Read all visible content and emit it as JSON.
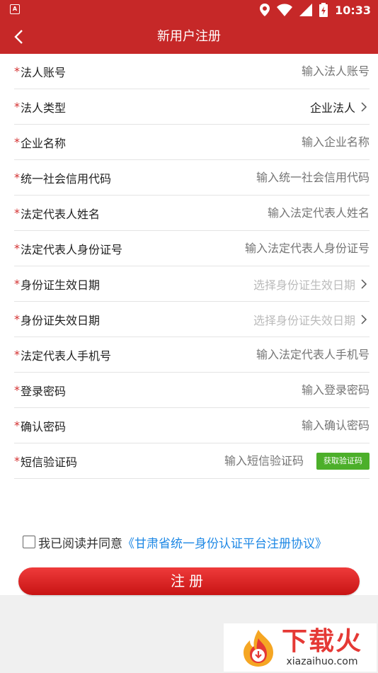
{
  "status": {
    "time": "10:33",
    "app_icon_letter": "A"
  },
  "header": {
    "title": "新用户注册"
  },
  "form": {
    "required_mark": "*",
    "fields": [
      {
        "label": "法人账号",
        "placeholder": "输入法人账号",
        "value": "",
        "type": "input"
      },
      {
        "label": "法人类型",
        "placeholder": "",
        "value": "企业法人",
        "type": "select"
      },
      {
        "label": "企业名称",
        "placeholder": "输入企业名称",
        "value": "",
        "type": "input"
      },
      {
        "label": "统一社会信用代码",
        "placeholder": "输入统一社会信用代码",
        "value": "",
        "type": "input"
      },
      {
        "label": "法定代表人姓名",
        "placeholder": "输入法定代表人姓名",
        "value": "",
        "type": "input"
      },
      {
        "label": "法定代表人身份证号",
        "placeholder": "输入法定代表人身份证号",
        "value": "",
        "type": "input"
      },
      {
        "label": "身份证生效日期",
        "placeholder": "选择身份证生效日期",
        "value": "",
        "type": "date"
      },
      {
        "label": "身份证失效日期",
        "placeholder": "选择身份证失效日期",
        "value": "",
        "type": "date"
      },
      {
        "label": "法定代表人手机号",
        "placeholder": "输入法定代表人手机号",
        "value": "",
        "type": "input"
      },
      {
        "label": "登录密码",
        "placeholder": "输入登录密码",
        "value": "",
        "type": "input"
      },
      {
        "label": "确认密码",
        "placeholder": "输入确认密码",
        "value": "",
        "type": "input"
      },
      {
        "label": "短信验证码",
        "placeholder": "输入短信验证码",
        "value": "",
        "type": "sms"
      }
    ],
    "sms_button_label": "获取验证码"
  },
  "agreement": {
    "prefix": "我已阅读并同意",
    "link": "《甘肃省统一身份认证平台注册协议》",
    "checked": false
  },
  "submit": {
    "label": "注册"
  },
  "watermark": {
    "brand": "下载火",
    "domain": "xiazaihuo.com"
  },
  "colors": {
    "primary": "#c62828",
    "link": "#1e88e5",
    "sms_button": "#4caf2a",
    "required": "#d32f2f"
  }
}
